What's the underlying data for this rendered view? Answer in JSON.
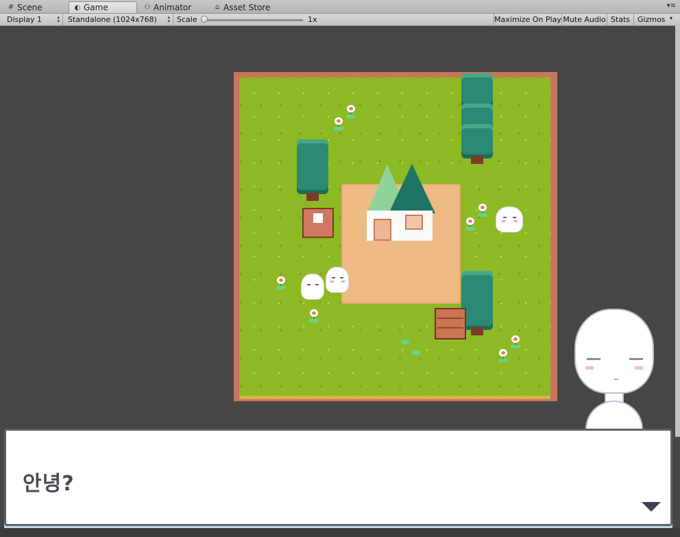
{
  "tabs": [
    {
      "label": "Scene",
      "icon": "grid-icon"
    },
    {
      "label": "Game",
      "icon": "pacman-icon",
      "active": true
    },
    {
      "label": "Animator",
      "icon": "animator-icon"
    },
    {
      "label": "Asset Store",
      "icon": "store-icon"
    }
  ],
  "toolbar": {
    "display": "Display 1",
    "resolution": "Standalone (1024x768)",
    "scale_label": "Scale",
    "scale_value": "1x",
    "maximize": "Maximize On Play",
    "mute": "Mute Audio",
    "stats": "Stats",
    "gizmos": "Gizmos"
  },
  "dialogue": {
    "text": "안녕?"
  },
  "colors": {
    "grass": "#8db924",
    "border": "#c7765c",
    "dirt": "#eeba84",
    "tree": "#2b8a73",
    "dialogue_text": "#4a4a56"
  }
}
